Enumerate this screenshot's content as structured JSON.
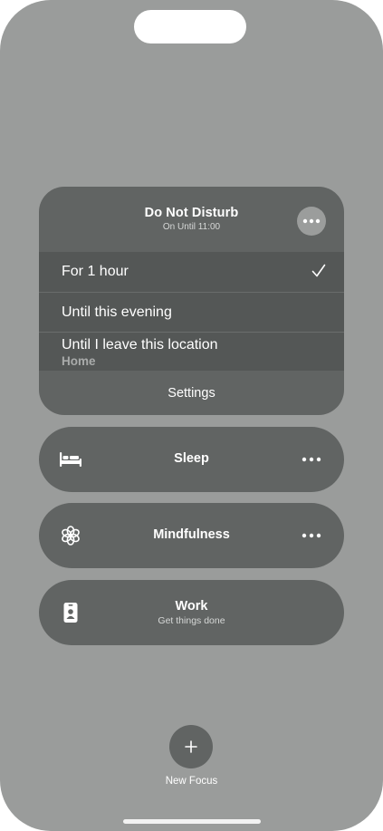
{
  "dnd": {
    "title": "Do Not Disturb",
    "subtitle": "On Until 11:00",
    "icon": "moon-icon",
    "options": [
      {
        "label": "For 1 hour",
        "selected": true
      },
      {
        "label": "Until this evening",
        "selected": false
      },
      {
        "label": "Until I leave this location",
        "sublabel": "Home",
        "selected": false
      }
    ],
    "settings_label": "Settings"
  },
  "focus_modes": [
    {
      "title": "Sleep",
      "icon": "bed-icon",
      "has_more": true
    },
    {
      "title": "Mindfulness",
      "icon": "flower-icon",
      "has_more": true
    },
    {
      "title": "Work",
      "subtitle": "Get things done",
      "icon": "id-badge-icon",
      "has_more": false
    }
  ],
  "new_focus": {
    "label": "New Focus",
    "icon": "plus-icon"
  },
  "colors": {
    "background": "#9a9c9b",
    "card": "#616463",
    "options_bg": "#545756",
    "more_circle": "#9b9d9c",
    "text": "#ffffff"
  }
}
